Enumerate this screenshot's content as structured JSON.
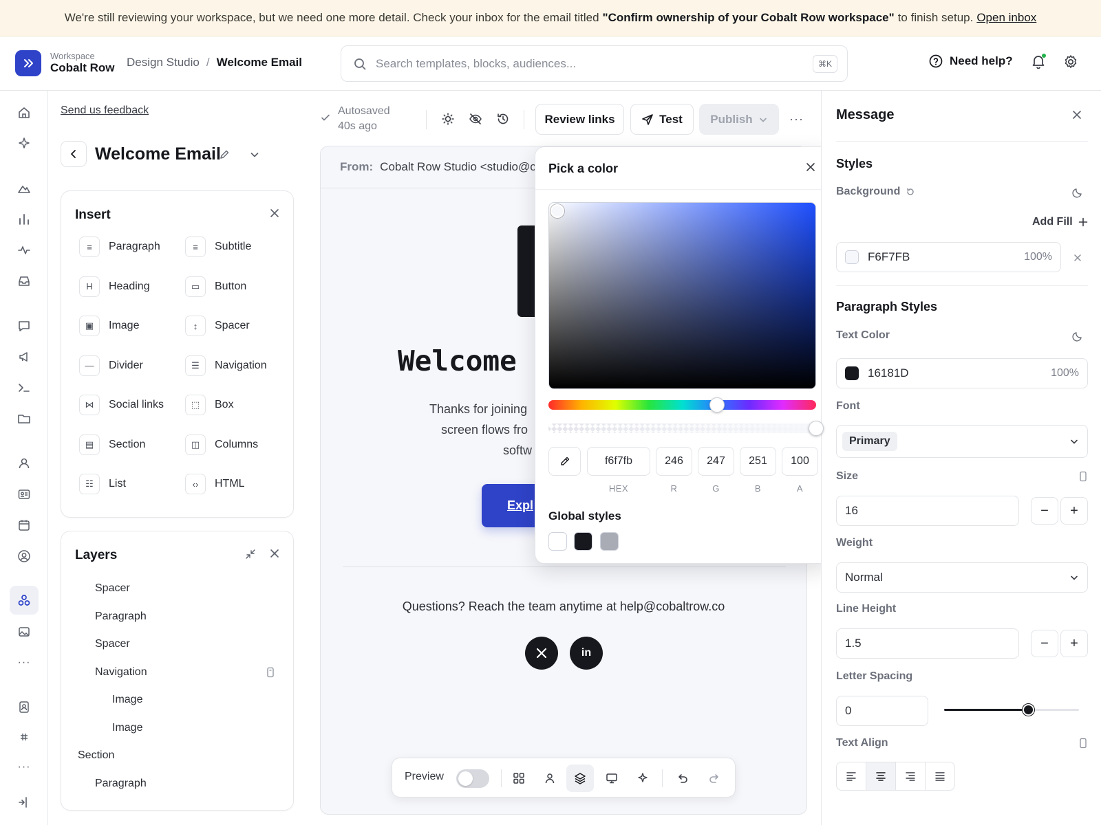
{
  "banner": {
    "text_before": "We're still reviewing your workspace, but we need one more detail. Check your inbox for the email titled",
    "email_title": "\"Confirm ownership of your Cobalt Row workspace\"",
    "text_after": "to finish setup.",
    "link": "Open inbox"
  },
  "header": {
    "workspace_label": "Workspace",
    "workspace_name": "Cobalt Row",
    "breadcrumb": [
      "Design Studio",
      "/",
      "Welcome Email"
    ],
    "search_placeholder": "Search templates, blocks, audiences...",
    "search_shortcut": "⌘K",
    "help": "Need help?"
  },
  "sidebar": {
    "feedback_link": "Send us feedback",
    "doc_title": "Welcome Email"
  },
  "insert": {
    "title": "Insert",
    "items": [
      {
        "label": "Paragraph",
        "icon": "paragraph-icon",
        "glyph": "≡"
      },
      {
        "label": "Subtitle",
        "icon": "subtitle-icon",
        "glyph": "≡"
      },
      {
        "label": "Heading",
        "icon": "heading-icon",
        "glyph": "H"
      },
      {
        "label": "Button",
        "icon": "button-icon",
        "glyph": "▭"
      },
      {
        "label": "Image",
        "icon": "image-icon",
        "glyph": "▣"
      },
      {
        "label": "Spacer",
        "icon": "spacer-icon",
        "glyph": "↕"
      },
      {
        "label": "Divider",
        "icon": "divider-icon",
        "glyph": "—"
      },
      {
        "label": "Navigation",
        "icon": "navigation-icon",
        "glyph": "☰"
      },
      {
        "label": "Social links",
        "icon": "social-links-icon",
        "glyph": "⋈"
      },
      {
        "label": "Box",
        "icon": "box-icon",
        "glyph": "⬚"
      },
      {
        "label": "Section",
        "icon": "section-icon",
        "glyph": "▤"
      },
      {
        "label": "Columns",
        "icon": "columns-icon",
        "glyph": "◫"
      },
      {
        "label": "List",
        "icon": "list-icon",
        "glyph": "☷"
      },
      {
        "label": "HTML",
        "icon": "html-icon",
        "glyph": "‹›"
      }
    ]
  },
  "layers": {
    "title": "Layers",
    "items": [
      {
        "label": "Spacer",
        "depth": 1
      },
      {
        "label": "Paragraph",
        "depth": 1
      },
      {
        "label": "Spacer",
        "depth": 1
      },
      {
        "label": "Navigation",
        "depth": 1
      },
      {
        "label": "Image",
        "depth": 2
      },
      {
        "label": "Image",
        "depth": 2
      },
      {
        "label": "Section",
        "depth": 0
      },
      {
        "label": "Paragraph",
        "depth": 1
      }
    ]
  },
  "toolbar": {
    "autosave_line1": "Autosaved",
    "autosave_line2": "40s ago",
    "review_links": "Review links",
    "test": "Test",
    "publish": "Publish",
    "more": "···"
  },
  "email": {
    "from_label": "From:",
    "from_value": "Cobalt Row Studio <studio@c",
    "heading": "Welcome t",
    "body_lines": [
      "Thanks for joining",
      "screen flows fro",
      "softw"
    ],
    "cta": "Expl",
    "footer": "Questions? Reach the team anytime at help@cobaltrow.co",
    "social": [
      "X",
      "in"
    ]
  },
  "bottombar": {
    "preview_label": "Preview",
    "preview_on": false
  },
  "picker": {
    "title": "Pick a color",
    "hex": "f6f7fb",
    "r": "246",
    "g": "247",
    "b": "251",
    "a": "100",
    "labels": [
      "HEX",
      "R",
      "G",
      "B",
      "A"
    ],
    "global_styles_title": "Global styles",
    "global_swatches": [
      "#ffffff",
      "#16181d",
      "#a9acb5"
    ],
    "hue_position": 0.63,
    "alpha_position": 1.0
  },
  "panel": {
    "title": "Message",
    "styles_title": "Styles",
    "background_label": "Background",
    "add_fill": "Add Fill",
    "bg_hex": "F6F7FB",
    "bg_opacity": "100%",
    "bg_color": "#f6f7fb",
    "paragraph_styles_title": "Paragraph Styles",
    "text_color_label": "Text Color",
    "text_hex": "16181D",
    "text_opacity": "100%",
    "text_color": "#16181d",
    "font_label": "Font",
    "font_value": "Primary",
    "size_label": "Size",
    "size_value": "16",
    "weight_label": "Weight",
    "weight_value": "Normal",
    "line_height_label": "Line Height",
    "line_height_value": "1.5",
    "letter_spacing_label": "Letter Spacing",
    "letter_spacing_value": "0",
    "letter_spacing_slider": 0.62,
    "text_align_label": "Text Align",
    "text_align_selected": "center"
  },
  "colors": {
    "accent": "#2f43c9",
    "text": "#16181d",
    "banner_bg": "#fdf6e8"
  }
}
